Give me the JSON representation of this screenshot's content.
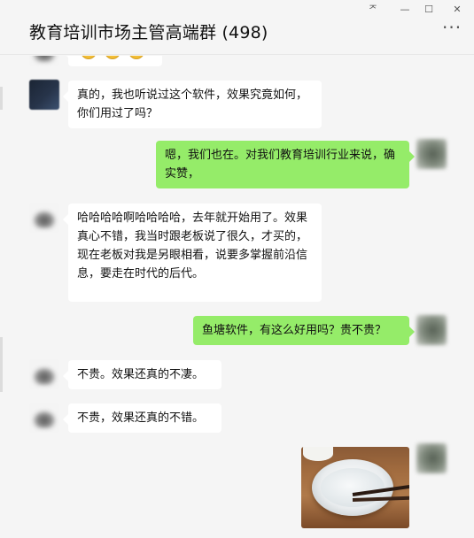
{
  "window": {
    "title": "教育培训市场主管高端群 (498)",
    "pin_glyph": "ᅎ",
    "minimize_glyph": "—",
    "maximize_glyph": "☐",
    "close_glyph": "✕",
    "more_glyph": "···"
  },
  "messages": [
    {
      "side": "left",
      "type": "emoji",
      "icon": "smiley-emoji",
      "count": 3
    },
    {
      "side": "left",
      "type": "text",
      "avatar": "dark-avatar",
      "text": "真的，我也听说过这个软件，效果究竟如何，你们用过了吗？"
    },
    {
      "side": "right",
      "type": "text",
      "avatar": "self-avatar",
      "text": "嗯，我们也在。对我们教育培训行业来说，确实赞，"
    },
    {
      "side": "left",
      "type": "text",
      "avatar": "logo-avatar",
      "text": "哈哈哈哈啊哈哈哈哈，去年就开始用了。效果真心不错，我当时跟老板说了很久，才买的，现在老板对我是另眼相看，说要多掌握前沿信息，要走在时代的后代。"
    },
    {
      "side": "right",
      "type": "text",
      "avatar": "self-avatar",
      "text": "鱼塘软件，有这么好用吗？贵不贵？"
    },
    {
      "side": "left",
      "type": "text",
      "avatar": "logo-avatar",
      "text": "不贵。效果还真的不凄。"
    },
    {
      "side": "left",
      "type": "text",
      "avatar": "logo-avatar",
      "text": "不贵，效果还真的不错。"
    },
    {
      "side": "right",
      "type": "image",
      "avatar": "self-avatar",
      "image": "photo-bowl-of-milk-with-chopsticks"
    }
  ],
  "colors": {
    "background": "#f5f5f5",
    "bubble_left": "#ffffff",
    "bubble_right": "#95ec69"
  }
}
